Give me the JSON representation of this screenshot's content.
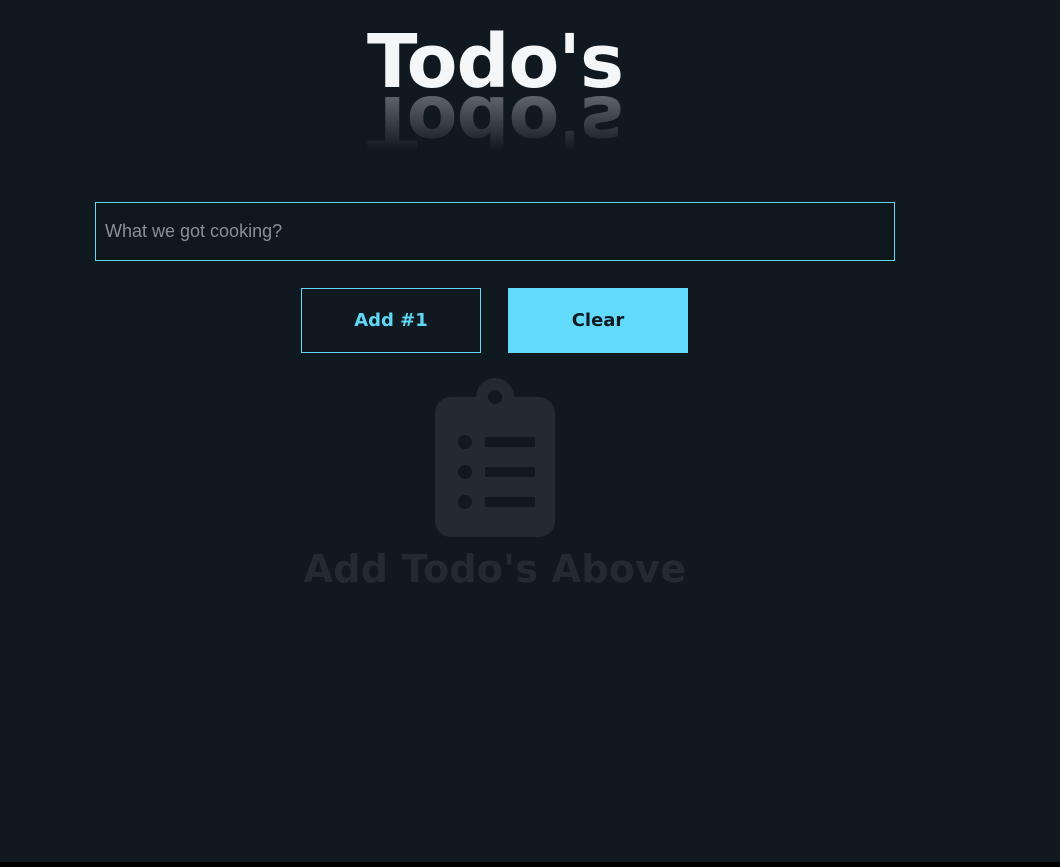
{
  "app": {
    "title": "Todo's"
  },
  "input": {
    "placeholder": "What we got cooking?",
    "value": ""
  },
  "buttons": {
    "add_label": "Add #1",
    "clear_label": "Clear"
  },
  "empty_state": {
    "icon": "clipboard-list-icon",
    "message": "Add Todo's Above"
  },
  "colors": {
    "background": "#101820",
    "accent": "#5fd7f5",
    "title": "#f4f6f8",
    "muted": "#232a32"
  }
}
